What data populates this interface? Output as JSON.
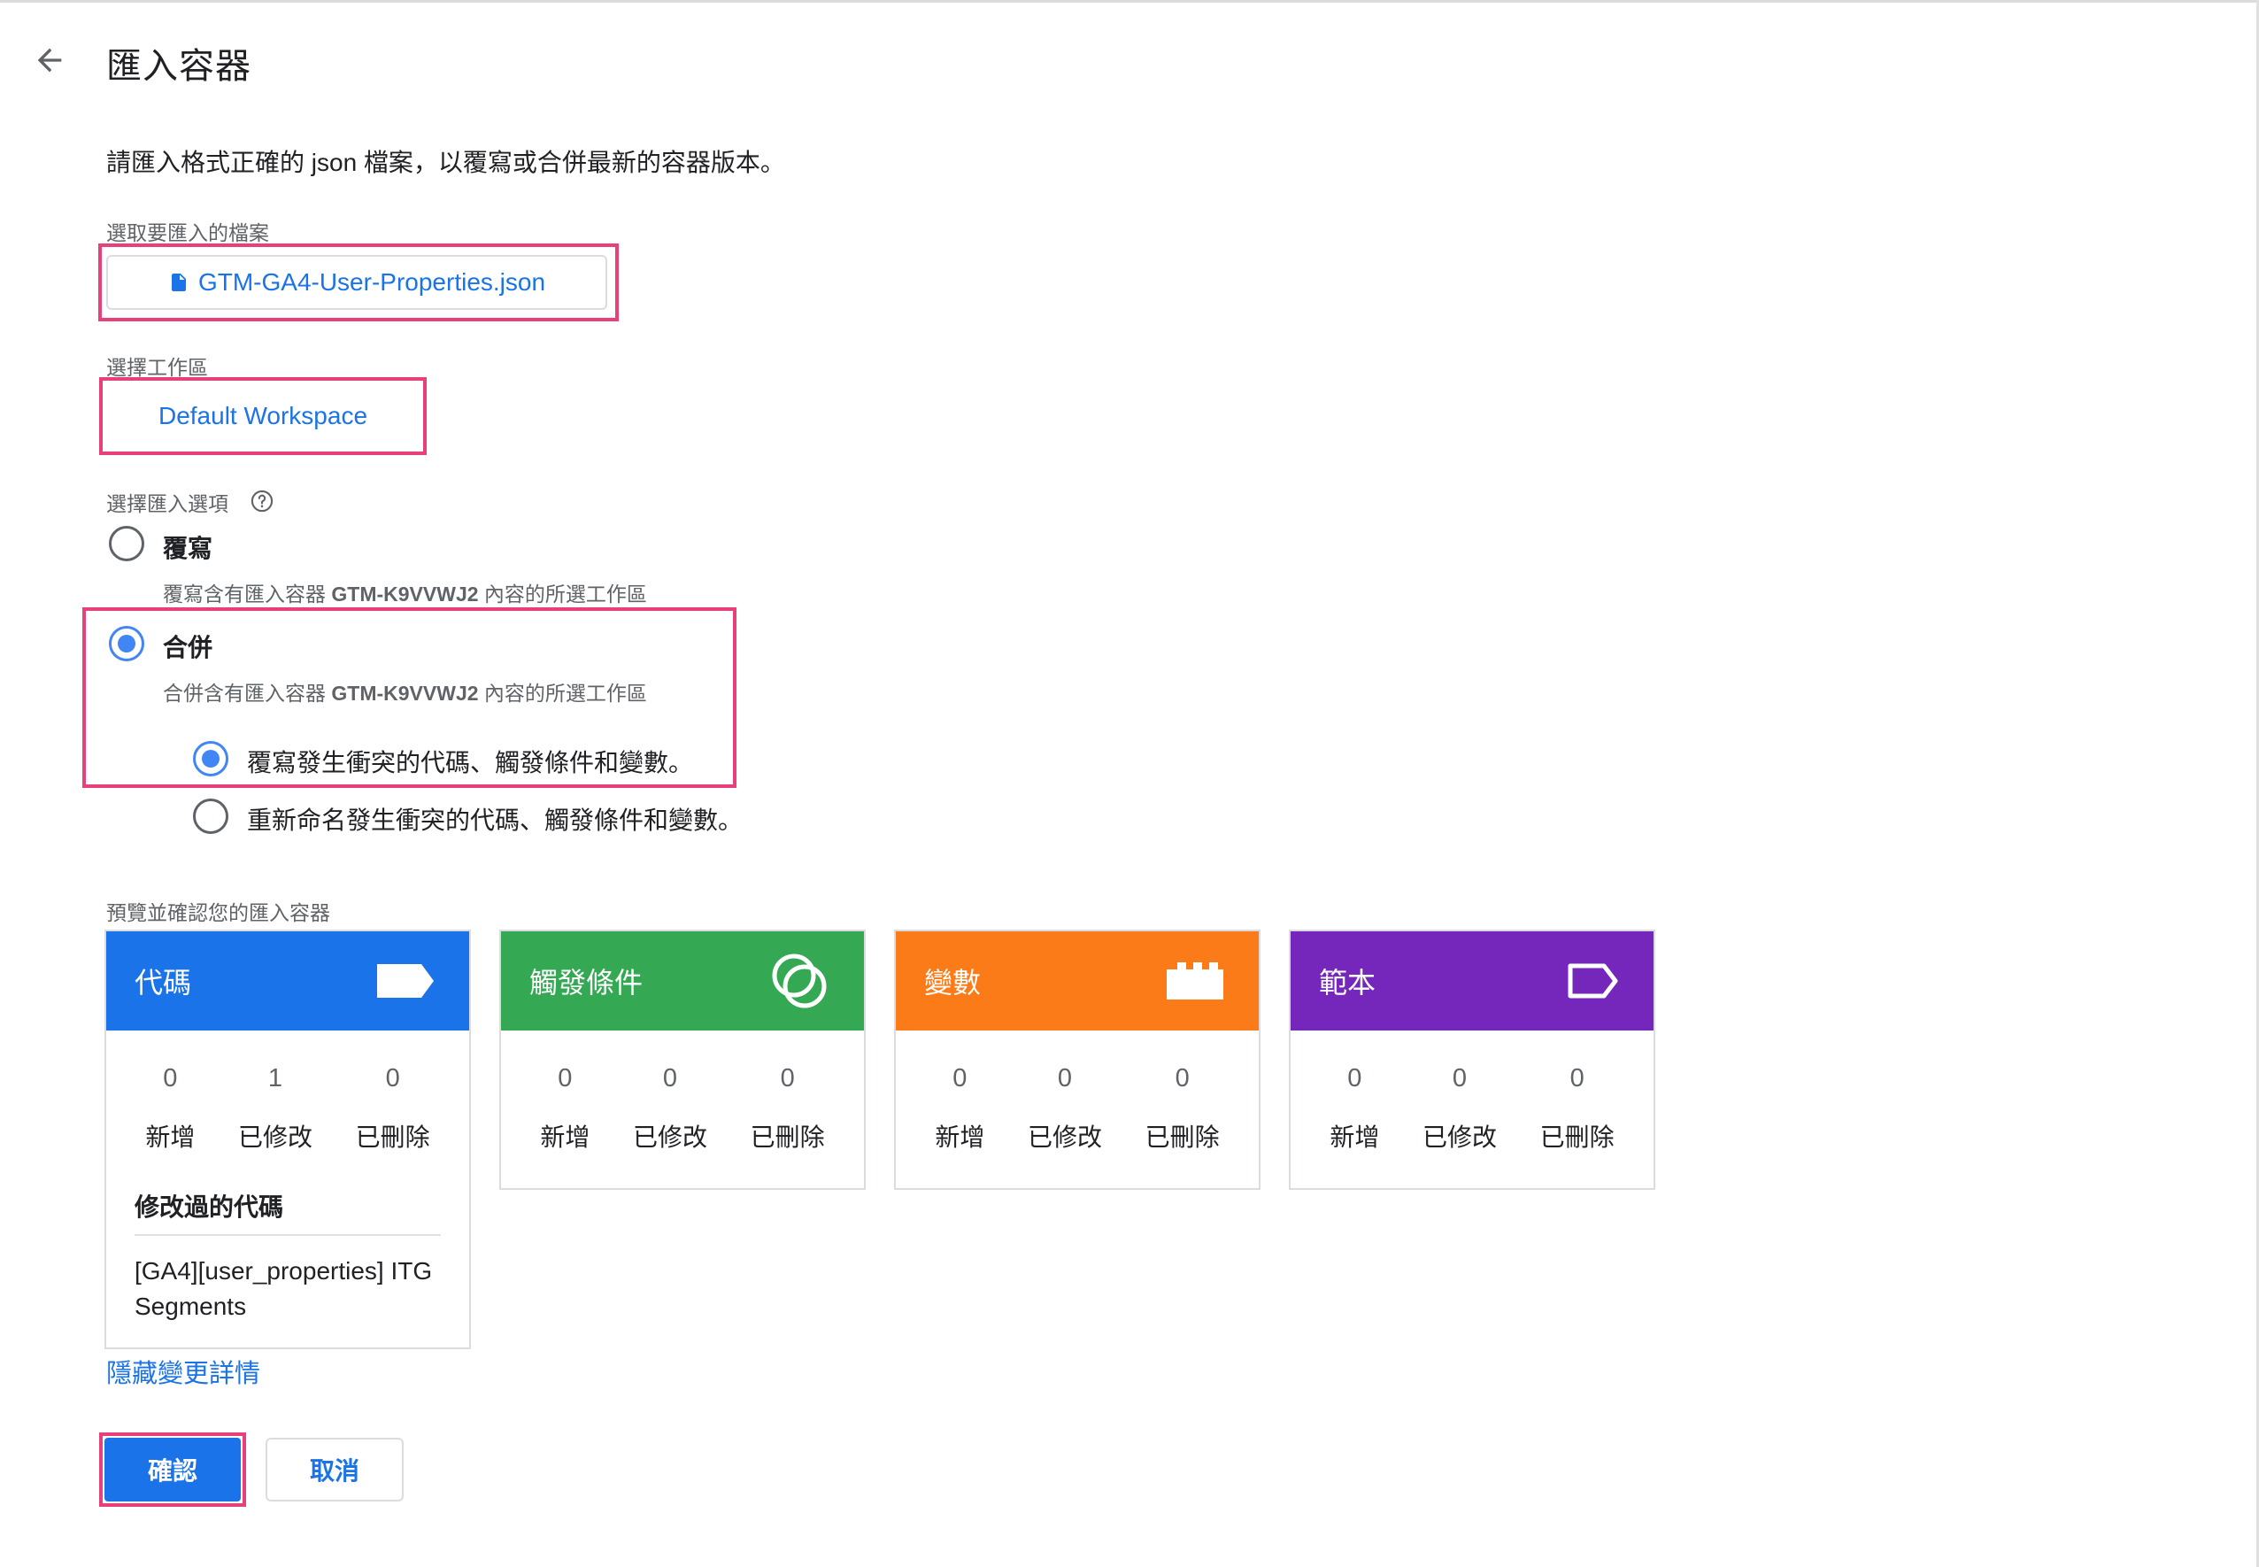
{
  "header": {
    "title": "匯入容器",
    "back_icon": "arrow-back-icon"
  },
  "description": "請匯入格式正確的 json 檔案，以覆寫或合併最新的容器版本。",
  "file_section": {
    "label": "選取要匯入的檔案",
    "file_name": "GTM-GA4-User-Properties.json",
    "icon": "file-icon"
  },
  "workspace_section": {
    "label": "選擇工作區",
    "value": "Default Workspace"
  },
  "import_options": {
    "label": "選擇匯入選項",
    "help_icon": "help-icon",
    "overwrite": {
      "label": "覆寫",
      "desc_prefix": "覆寫含有匯入容器 ",
      "container_id": "GTM-K9VVWJ2",
      "desc_suffix": " 內容的所選工作區",
      "selected": false
    },
    "merge": {
      "label": "合併",
      "desc_prefix": "合併含有匯入容器 ",
      "container_id": "GTM-K9VVWJ2",
      "desc_suffix": " 內容的所選工作區",
      "selected": true
    },
    "merge_suboptions": [
      {
        "label": "覆寫發生衝突的代碼、觸發條件和變數。",
        "selected": true
      },
      {
        "label": "重新命名發生衝突的代碼、觸發條件和變數。",
        "selected": false
      }
    ]
  },
  "preview": {
    "label": "預覽並確認您的匯入容器",
    "stat_labels": {
      "added": "新增",
      "modified": "已修改",
      "deleted": "已刪除"
    },
    "cards": [
      {
        "title": "代碼",
        "color": "#1a73e8",
        "icon": "tag-icon",
        "added": "0",
        "modified": "1",
        "deleted": "0",
        "modified_title": "修改過的代碼",
        "modified_items": [
          "[GA4][user_properties] ITG Segments"
        ]
      },
      {
        "title": "觸發條件",
        "color": "#34a853",
        "icon": "trigger-icon",
        "added": "0",
        "modified": "0",
        "deleted": "0"
      },
      {
        "title": "變數",
        "color": "#fa7b17",
        "icon": "variable-icon",
        "added": "0",
        "modified": "0",
        "deleted": "0"
      },
      {
        "title": "範本",
        "color": "#7627bb",
        "icon": "template-icon",
        "added": "0",
        "modified": "0",
        "deleted": "0"
      }
    ],
    "hide_details": "隱藏變更詳情"
  },
  "actions": {
    "confirm": "確認",
    "cancel": "取消"
  },
  "highlight_color": "#e8407a"
}
